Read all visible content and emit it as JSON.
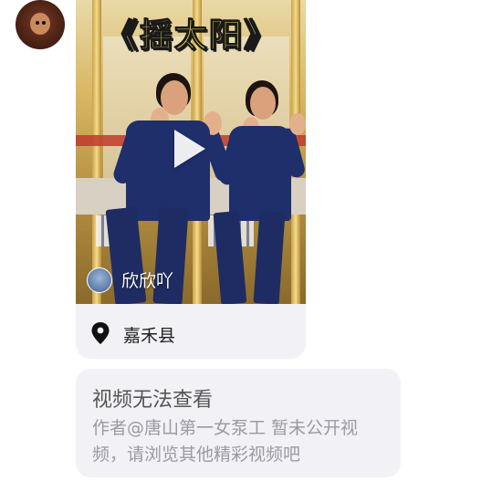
{
  "sender": {
    "avatar_icon": "user-avatar"
  },
  "video_card": {
    "overlay_title": "《摇太阳》",
    "author_name": "欣欣吖",
    "location": "嘉禾县",
    "play_icon": "play-icon"
  },
  "notice": {
    "title": "视频无法查看",
    "author_prefix": "作者@唐山第一女泵工",
    "message": " 暂未公开视频，请浏览其他精彩视频吧"
  },
  "colors": {
    "bubble_bg": "#f2f1f6",
    "title_yellow": "#f7e04a",
    "muted_text": "#9a9aa0"
  }
}
